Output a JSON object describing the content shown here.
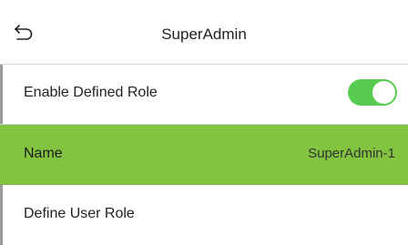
{
  "header": {
    "title": "SuperAdmin",
    "back_icon": "back-return-icon"
  },
  "settings": [
    {
      "label": "Enable Defined Role",
      "control": "toggle",
      "toggle_on": true
    },
    {
      "label": "Name",
      "value": "SuperAdmin-1",
      "selected": true
    },
    {
      "label": "Define User Role"
    }
  ],
  "colors": {
    "selected_row": "#82c43f",
    "toggle_on": "#58cc50",
    "background": "#ffffff",
    "divider": "#d6d6d6"
  }
}
